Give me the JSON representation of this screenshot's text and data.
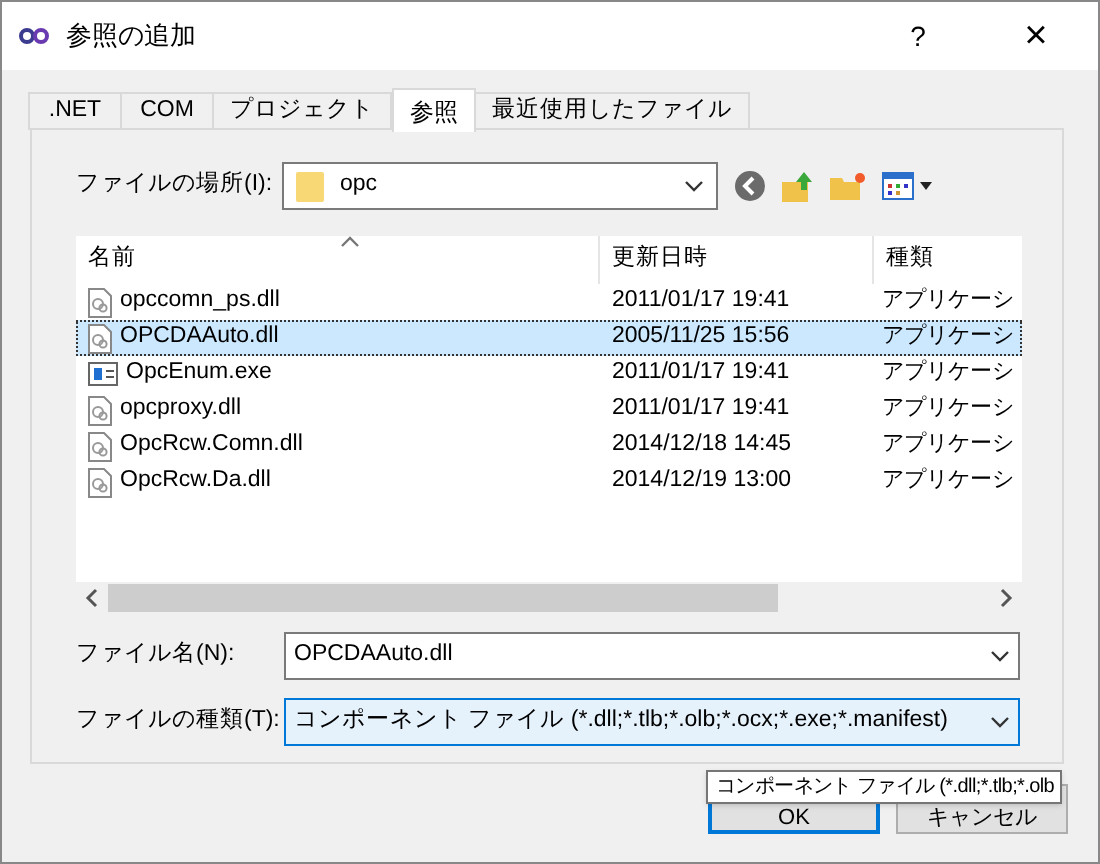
{
  "window": {
    "title": "参照の追加",
    "help": "?",
    "close": "×"
  },
  "tabs": [
    {
      "label": ".NET",
      "selected": false
    },
    {
      "label": "COM",
      "selected": false
    },
    {
      "label": "プロジェクト",
      "selected": false
    },
    {
      "label": "参照",
      "selected": true
    },
    {
      "label": "最近使用したファイル",
      "selected": false
    }
  ],
  "location": {
    "label": "ファイルの場所(I):",
    "value": "opc"
  },
  "file_list": {
    "columns": [
      "名前",
      "更新日時",
      "種類"
    ],
    "rows": [
      {
        "name": "opccomn_ps.dll",
        "modified": "2011/01/17 19:41",
        "type": "アプリケーシ",
        "kind": "dll",
        "selected": false
      },
      {
        "name": "OPCDAAuto.dll",
        "modified": "2005/11/25 15:56",
        "type": "アプリケーシ",
        "kind": "dll",
        "selected": true
      },
      {
        "name": "OpcEnum.exe",
        "modified": "2011/01/17 19:41",
        "type": "アプリケーシ",
        "kind": "exe",
        "selected": false
      },
      {
        "name": "opcproxy.dll",
        "modified": "2011/01/17 19:41",
        "type": "アプリケーシ",
        "kind": "dll",
        "selected": false
      },
      {
        "name": "OpcRcw.Comn.dll",
        "modified": "2014/12/18 14:45",
        "type": "アプリケーシ",
        "kind": "dll",
        "selected": false
      },
      {
        "name": "OpcRcw.Da.dll",
        "modified": "2014/12/19 13:00",
        "type": "アプリケーシ",
        "kind": "dll",
        "selected": false
      }
    ]
  },
  "file_name": {
    "label": "ファイル名(N):",
    "value": "OPCDAAuto.dll"
  },
  "file_type": {
    "label": "ファイルの種類(T):",
    "value": "コンポーネント ファイル (*.dll;*.tlb;*.olb;*.ocx;*.exe;*.manifest)"
  },
  "buttons": [
    "OK",
    "キャンセル"
  ],
  "tooltip": "コンポーネント ファイル (*.dll;*.tlb;*.olb"
}
